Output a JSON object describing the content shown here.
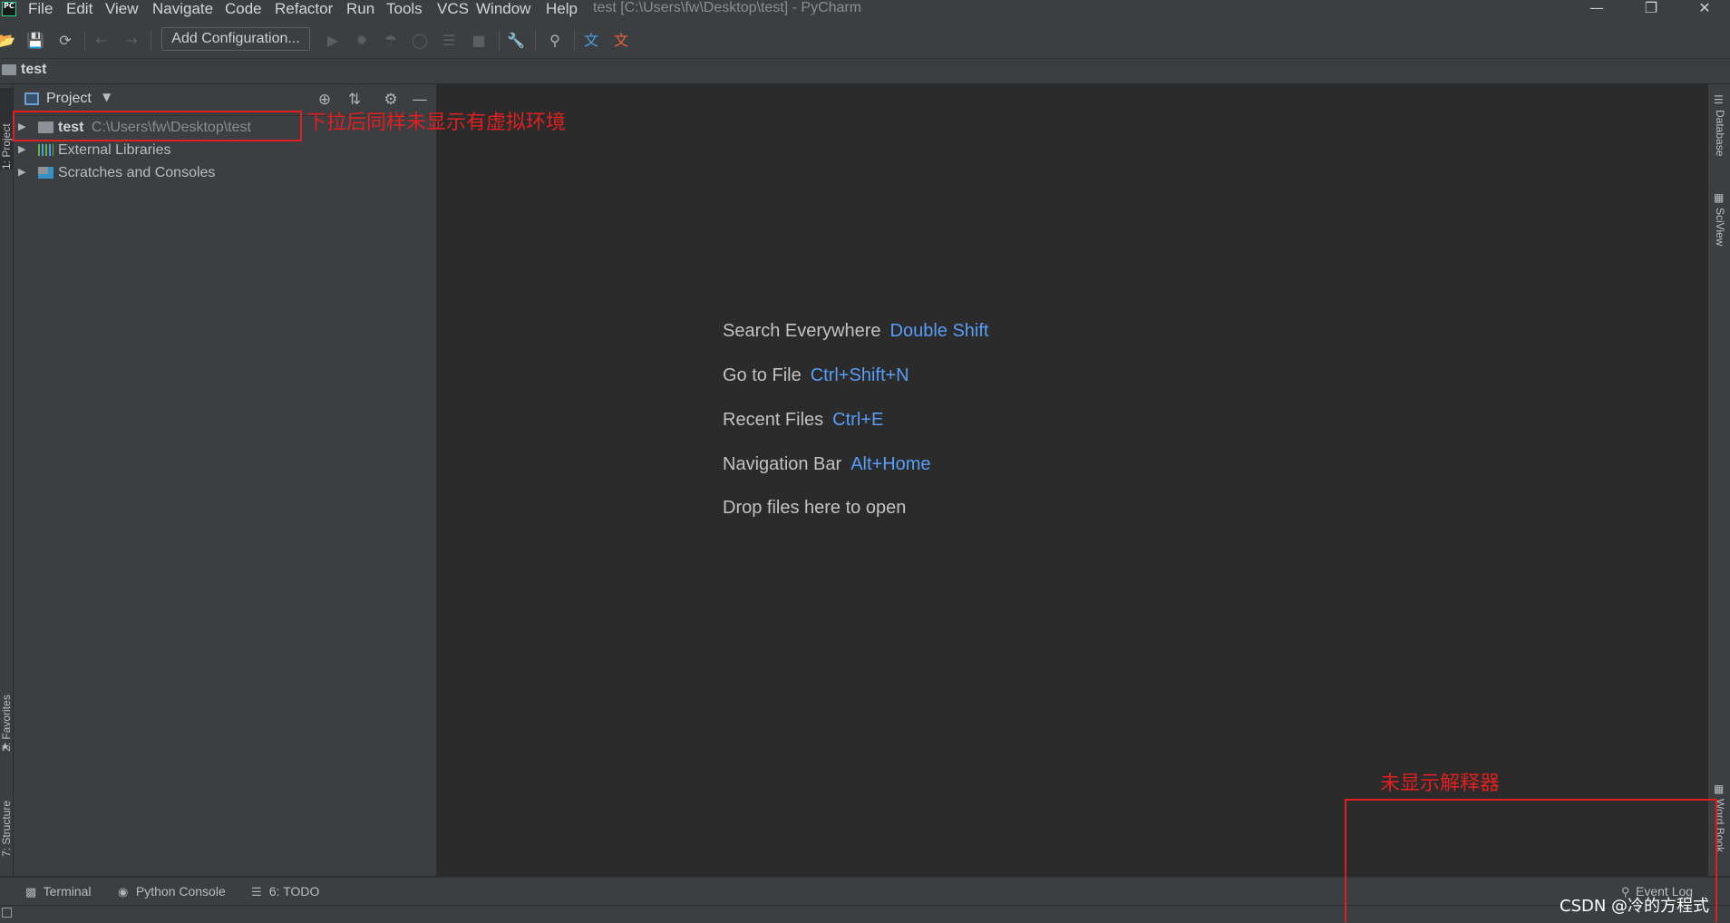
{
  "app": {
    "logo_text": "PC",
    "window_title": "test [C:\\Users\\fw\\Desktop\\test] - PyCharm"
  },
  "menu": [
    "File",
    "Edit",
    "View",
    "Navigate",
    "Code",
    "Refactor",
    "Run",
    "Tools",
    "VCS",
    "Window",
    "Help"
  ],
  "toolbar": {
    "run_config_label": "Add Configuration..."
  },
  "navbar": {
    "breadcrumb": "test"
  },
  "left_stripe": {
    "project_tab": "1: Project",
    "favorites_tab": "2: Favorites",
    "structure_tab": "7: Structure"
  },
  "project_panel": {
    "title": "Project",
    "tree": [
      {
        "name": "test",
        "path": "C:\\Users\\fw\\Desktop\\test"
      },
      {
        "name": "External Libraries"
      },
      {
        "name": "Scratches and Consoles"
      }
    ]
  },
  "editor": {
    "hints": [
      {
        "label": "Search Everywhere",
        "shortcut": "Double Shift"
      },
      {
        "label": "Go to File",
        "shortcut": "Ctrl+Shift+N"
      },
      {
        "label": "Recent Files",
        "shortcut": "Ctrl+E"
      },
      {
        "label": "Navigation Bar",
        "shortcut": "Alt+Home"
      },
      {
        "label": "Drop files here to open",
        "shortcut": ""
      }
    ],
    "shortcut_color": "#589df6"
  },
  "right_stripe": {
    "database_tab": "Database",
    "sciview_tab": "SciView",
    "wordbook_tab": "Word Book"
  },
  "bottom_bar": {
    "terminal": "Terminal",
    "python_console": "Python Console",
    "todo": "6: TODO",
    "event_log": "Event Log"
  },
  "annotations": {
    "tree_note": "下拉后同样未显示有虚拟环境",
    "interpreter_note": "未显示解释器",
    "color": "#e02020"
  },
  "watermark": "CSDN @冷的方程式"
}
